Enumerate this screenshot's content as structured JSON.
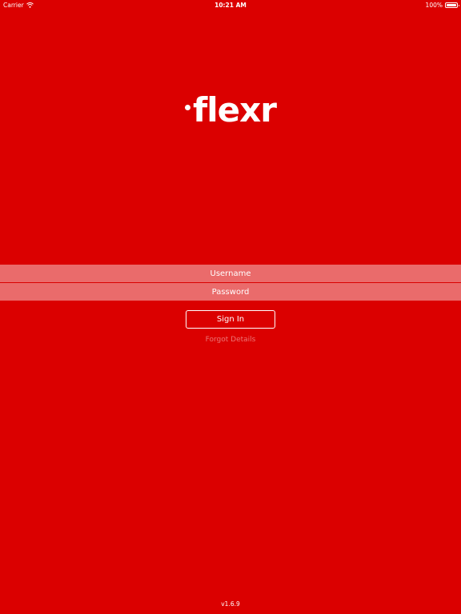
{
  "status_bar": {
    "carrier": "Carrier",
    "time": "10:21 AM",
    "battery": "100%",
    "battery_level": 1.0,
    "wifi_icon": "wifi-icon",
    "battery_icon": "battery-icon"
  },
  "logo": {
    "text": "flexr"
  },
  "login": {
    "username_placeholder": "Username",
    "password_placeholder": "Password",
    "sign_in_label": "Sign In",
    "forgot_label": "Forgot Details"
  },
  "footer": {
    "version": "v1.6.9"
  },
  "colors": {
    "background": "#db0000",
    "text": "#ffffff"
  }
}
